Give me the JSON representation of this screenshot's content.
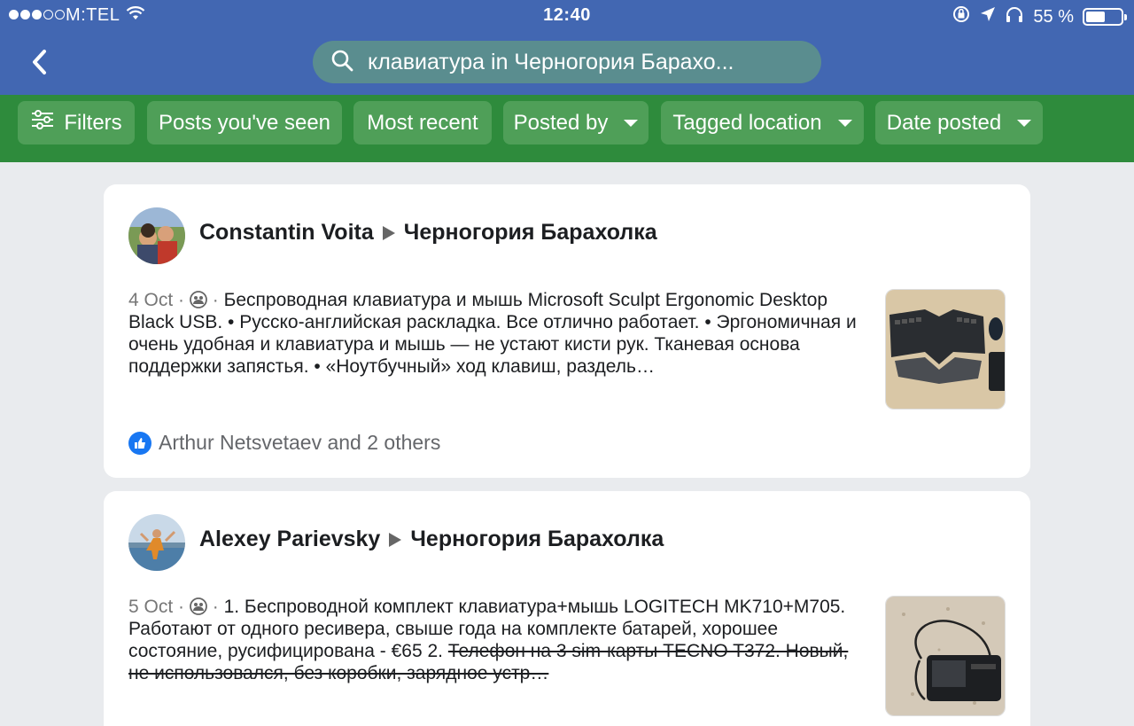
{
  "status_bar": {
    "carrier": "M:TEL",
    "time": "12:40",
    "battery": "55 %",
    "battery_level": 0.55
  },
  "nav": {
    "back_icon": "chevron-left-icon",
    "search_text": "клавиатура in Черногория Барахо..."
  },
  "filters": [
    {
      "label": "Filters",
      "icon": "sliders-icon"
    },
    {
      "label": "Posts you've seen"
    },
    {
      "label": "Most recent"
    },
    {
      "label": "Posted by",
      "dropdown": true
    },
    {
      "label": "Tagged location",
      "dropdown": true
    },
    {
      "label": "Date posted",
      "dropdown": true
    }
  ],
  "posts": [
    {
      "author": "Constantin Voita",
      "group": "Черногория Барахолка",
      "date": "4 Oct",
      "separator": "·",
      "text": "Беспроводная клавиатура и мышь Microsoft Sculpt Ergonomic Desktop Black USB.  • Русско-английская раскладка. Все отлично работает.  • Эргономичная и очень удобная и клавиатура и мышь — не устают кисти рук. Тканевая основа поддержки запястья.  • «Ноутбучный» ход клавиш, раздель…",
      "likes": "Arthur Netsvetaev and 2 others"
    },
    {
      "author": "Alexey Parievsky",
      "group": "Черногория Барахолка",
      "date": "5 Oct",
      "separator": "·",
      "text": "1. Беспроводной комплект клавиатура+мышь LOGITECH MK710+M705. Работают от одного ресивера, свыше года на комплекте батарей, хорошее состояние, русифицирована - €65 2. ",
      "text_struck": "Телефон на 3 sim-карты TECNO T372. Новый, не использовался, без коробки, зарядное устр…"
    }
  ],
  "colors": {
    "nav_blue": "#4267b2",
    "filter_green": "#2e8b3c",
    "chip_green": "#4f9f58",
    "search_bg": "#5a8d8f"
  }
}
